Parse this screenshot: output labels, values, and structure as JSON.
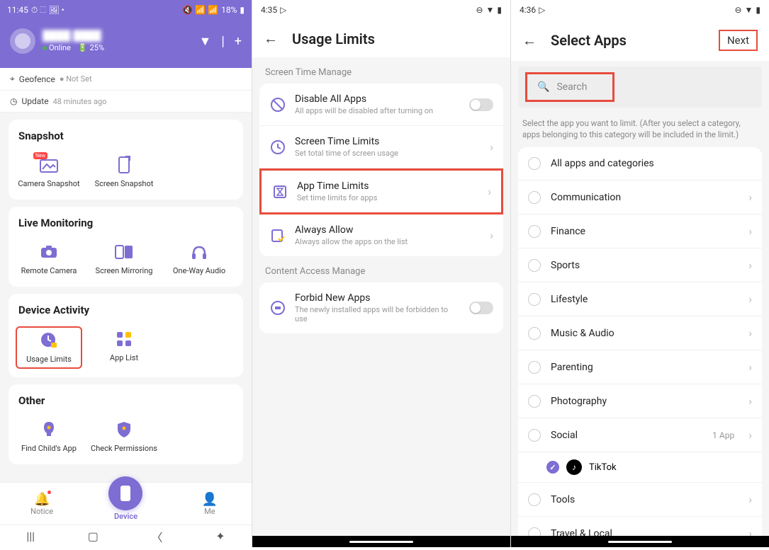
{
  "phone1": {
    "status": {
      "time": "11:45",
      "battery": "18%"
    },
    "header": {
      "name": "████ ████",
      "online": "Online",
      "battery": "25%"
    },
    "info": {
      "geofence_label": "Geofence",
      "geofence_status": "Not Set",
      "update_label": "Update",
      "update_time": "48 minutes ago"
    },
    "sections": {
      "snapshot": {
        "title": "Snapshot",
        "items": [
          "Camera Snapshot",
          "Screen Snapshot"
        ]
      },
      "live": {
        "title": "Live Monitoring",
        "items": [
          "Remote Camera",
          "Screen Mirroring",
          "One-Way Audio"
        ]
      },
      "device": {
        "title": "Device Activity",
        "items": [
          "Usage Limits",
          "App List"
        ]
      },
      "other": {
        "title": "Other",
        "items": [
          "Find Child's App",
          "Check Permissions"
        ]
      }
    },
    "nav": {
      "notice": "Notice",
      "device": "Device",
      "me": "Me"
    }
  },
  "phone2": {
    "status": {
      "time": "4:35"
    },
    "title": "Usage Limits",
    "section1": "Screen Time Manage",
    "rows": [
      {
        "title": "Disable All Apps",
        "sub": "All apps will be disabled after turning on",
        "toggle": true
      },
      {
        "title": "Screen Time Limits",
        "sub": "Set total time of screen usage",
        "arrow": true
      },
      {
        "title": "App Time Limits",
        "sub": "Set time limits for apps",
        "arrow": true,
        "highlight": true
      },
      {
        "title": "Always Allow",
        "sub": "Always allow the apps on the list",
        "arrow": true
      }
    ],
    "section2": "Content Access Manage",
    "rows2": [
      {
        "title": "Forbid New Apps",
        "sub": "The newly installed apps will be forbidden to use",
        "toggle": true
      }
    ]
  },
  "phone3": {
    "status": {
      "time": "4:36"
    },
    "title": "Select Apps",
    "next": "Next",
    "search_placeholder": "Search",
    "helper": "Select the app you want to limit. (After you select a category, apps belonging to this category will be included in the limit.)",
    "categories": [
      {
        "label": "All apps and categories"
      },
      {
        "label": "Communication",
        "arrow": true
      },
      {
        "label": "Finance",
        "arrow": true
      },
      {
        "label": "Sports",
        "arrow": true
      },
      {
        "label": "Lifestyle",
        "arrow": true
      },
      {
        "label": "Music & Audio",
        "arrow": true
      },
      {
        "label": "Parenting",
        "arrow": true
      },
      {
        "label": "Photography",
        "arrow": true
      },
      {
        "label": "Social",
        "count": "1 App",
        "arrow": true
      },
      {
        "label": "Tools",
        "arrow": true
      },
      {
        "label": "Travel & Local",
        "arrow": true
      }
    ],
    "selected_app": "TikTok"
  }
}
